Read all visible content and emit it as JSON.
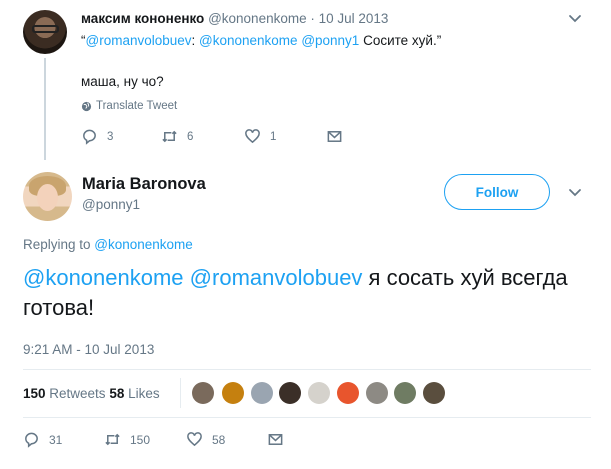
{
  "parent_tweet": {
    "author_name": "максим кононенко",
    "author_handle": "@kononenkome",
    "dot": "·",
    "date": "10 Jul 2013",
    "quote_open": "“",
    "mention1": "@romanvolobuev",
    "colon1": ": ",
    "mention2": "@kononenkome",
    "space": " ",
    "mention3": "@ponny1",
    "quote_rest": " Сосите хуй.”",
    "text": "маша, ну чо?",
    "translate": "Translate Tweet",
    "replies": "3",
    "retweets": "6",
    "likes": "1"
  },
  "main_tweet": {
    "author_name": "Maria Baronova",
    "author_handle": "@ponny1",
    "follow_label": "Follow",
    "replying_prefix": "Replying to ",
    "replying_to": "@kononenkome",
    "mention1": "@kononenkome",
    "mention2": "@romanvolobuev",
    "text_rest": " я сосать хуй всегда готова!",
    "timestamp": "9:21 AM - 10 Jul 2013",
    "retweets_count": "150",
    "retweets_label": " Retweets ",
    "likes_count": "58",
    "likes_label": " Likes",
    "replies": "31",
    "retweets": "150",
    "likes": "58"
  },
  "colors": {
    "accent": "#1da1f2",
    "muted": "#657786",
    "text": "#14171a",
    "divider": "#e6ecf0"
  },
  "icons": [
    "chevron-down-icon",
    "globe-icon",
    "reply-icon",
    "retweet-icon",
    "like-icon",
    "message-icon"
  ]
}
